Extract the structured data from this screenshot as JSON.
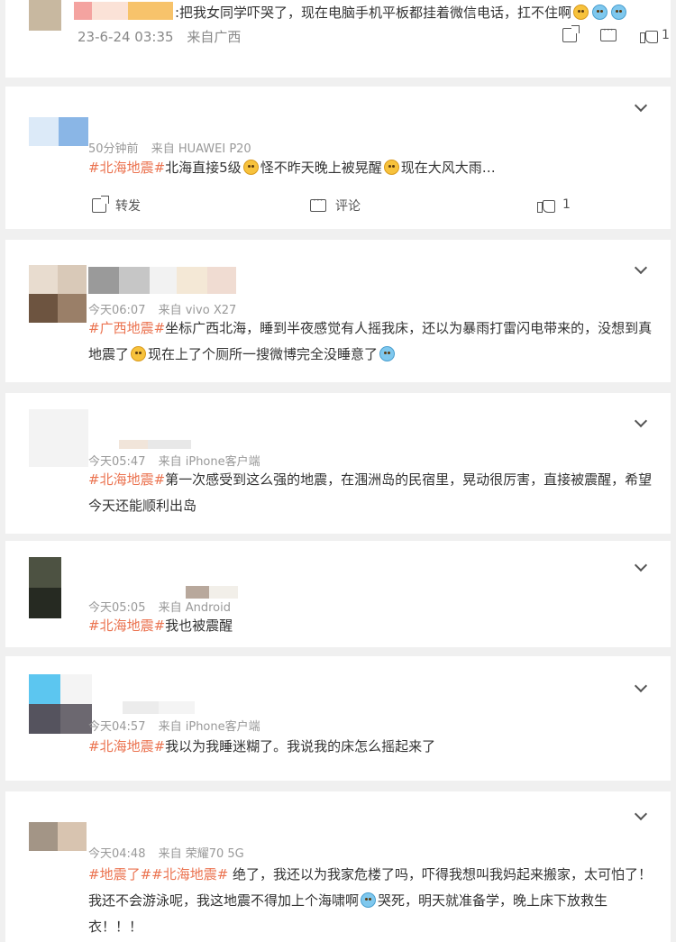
{
  "top_comment": {
    "text": ":把我女同学吓哭了，现在电脑手机平板都挂着微信电话，扛不住啊",
    "date": "23-6-24 03:35",
    "source": "来自广西",
    "like_count": "1"
  },
  "post": {
    "time": "50分钟前",
    "source": "来自 HUAWEI P20",
    "tag": "#北海地震#",
    "text1": "北海直接5级",
    "text2": "怪不昨天晚上被晃醒",
    "text3": "现在大风大雨…",
    "repost_label": "转发",
    "comment_label": "评论",
    "like_count": "1"
  },
  "comments": [
    {
      "time": "今天06:07",
      "source": "来自 vivo X27",
      "tag": "#广西地震#",
      "text_a": "坐标广西北海，睡到半夜感觉有人摇我床，还以为暴雨打雷闪电带来的，没想到真地震了",
      "text_b": "现在上了个厕所一搜微博完全没睡意了"
    },
    {
      "time": "今天05:47",
      "source": "来自 iPhone客户端",
      "tag": "#北海地震#",
      "text_a": "第一次感受到这么强的地震，在涠洲岛的民宿里，晃动很厉害，直接被震醒，希望今天还能顺利出岛"
    },
    {
      "time": "今天05:05",
      "source": "来自 Android",
      "tag": "#北海地震#",
      "text_a": "我也被震醒"
    },
    {
      "time": "今天04:57",
      "source": "来自 iPhone客户端",
      "tag": "#北海地震#",
      "text_a": "我以为我睡迷糊了。我说我的床怎么摇起来了"
    },
    {
      "time": "今天04:48",
      "source": "来自 荣耀70 5G",
      "tag1": "#地震了#",
      "tag2": "#北海地震#",
      "text_a": " 绝了，我还以为我家危楼了吗，吓得我想叫我妈起来搬家，太可怕了！我还不会游泳呢，我这地震不得加上个海啸啊",
      "text_b": "哭死，明天就准备学，晚上床下放救生衣！！！"
    }
  ],
  "icons": {
    "expand": "chevron-down-icon",
    "share": "share-icon",
    "comment": "comment-icon",
    "like": "like-icon",
    "emoji": "emoji-icon"
  },
  "colors": {
    "tag": "#eb7350",
    "meta": "#999999",
    "background": "#f0f0f0"
  }
}
